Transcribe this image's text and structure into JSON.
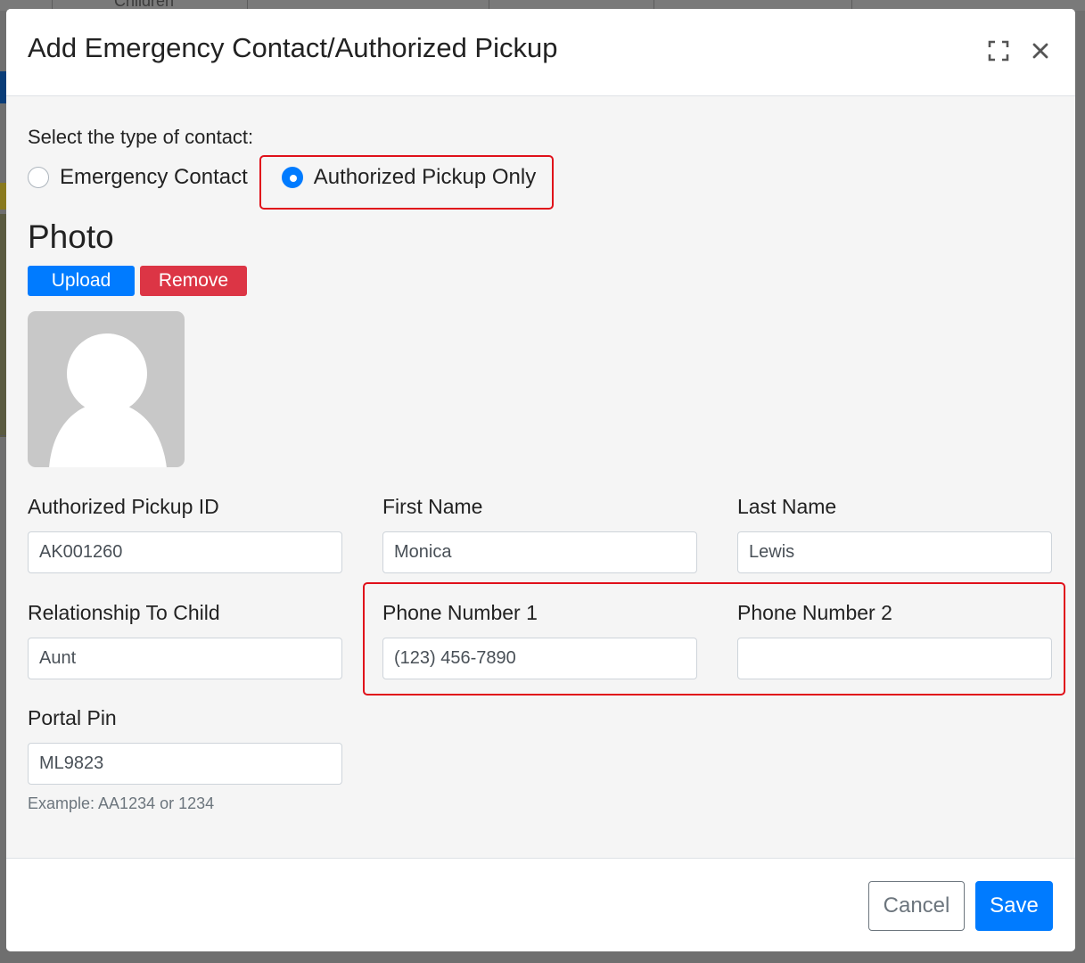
{
  "background": {
    "tab_label": "Children"
  },
  "modal": {
    "title": "Add Emergency Contact/Authorized Pickup",
    "expand_icon": "expand-icon",
    "close_icon": "close-icon"
  },
  "contact_type": {
    "label": "Select the type of contact:",
    "options": [
      {
        "label": "Emergency Contact",
        "checked": false
      },
      {
        "label": "Authorized Pickup Only",
        "checked": true
      }
    ]
  },
  "photo": {
    "heading": "Photo",
    "upload_label": "Upload",
    "remove_label": "Remove",
    "avatar_icon": "person-placeholder-icon"
  },
  "fields": {
    "pickup_id": {
      "label": "Authorized Pickup ID",
      "value": "AK001260"
    },
    "first_name": {
      "label": "First Name",
      "value": "Monica"
    },
    "last_name": {
      "label": "Last Name",
      "value": "Lewis"
    },
    "relationship": {
      "label": "Relationship To Child",
      "value": "Aunt"
    },
    "phone1": {
      "label": "Phone Number 1",
      "value": "(123) 456-7890"
    },
    "phone2": {
      "label": "Phone Number 2",
      "value": ""
    },
    "portal_pin": {
      "label": "Portal Pin",
      "value": "ML9823",
      "help": "Example: AA1234 or 1234"
    }
  },
  "footer": {
    "cancel_label": "Cancel",
    "save_label": "Save"
  },
  "colors": {
    "primary": "#007bff",
    "danger": "#dc3545",
    "highlight": "#e0101a",
    "modal_body": "#f5f5f5"
  }
}
